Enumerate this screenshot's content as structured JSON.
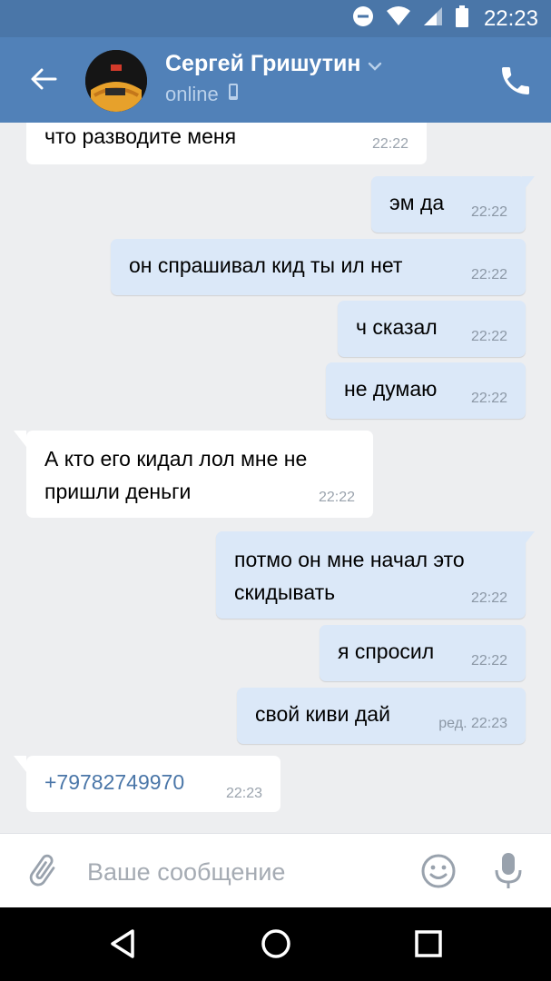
{
  "status_bar": {
    "time": "22:23",
    "icons": [
      "do-not-disturb-icon",
      "wifi-icon",
      "signal-icon",
      "battery-icon"
    ]
  },
  "header": {
    "contact_name": "Сергей Гришутин",
    "status": "online",
    "icons": [
      "back-arrow-icon",
      "chevron-down-icon",
      "mobile-icon",
      "phone-icon"
    ]
  },
  "messages": [
    {
      "dir": "in",
      "text": "что разводите меня",
      "time": "22:22"
    },
    {
      "dir": "out",
      "text": "эм да",
      "time": "22:22"
    },
    {
      "dir": "out",
      "text": "он спрашивал кид ты ил нет",
      "time": "22:22"
    },
    {
      "dir": "out",
      "text": "ч сказал",
      "time": "22:22"
    },
    {
      "dir": "out",
      "text": "не думаю",
      "time": "22:22"
    },
    {
      "dir": "in",
      "lines": [
        "А кто его кидал лол мне не",
        "пришли деньги"
      ],
      "time": "22:22"
    },
    {
      "dir": "out",
      "lines": [
        "потмо он мне начал это",
        "скидывать"
      ],
      "time": "22:22"
    },
    {
      "dir": "out",
      "text": "я спросил",
      "time": "22:22"
    },
    {
      "dir": "out",
      "text": "свой киви дай",
      "time": "ред. 22:23"
    },
    {
      "dir": "in",
      "text": "+79782749970",
      "time": "22:23"
    }
  ],
  "composer": {
    "placeholder": "Ваше сообщение",
    "icons": [
      "paperclip-icon",
      "emoji-icon",
      "microphone-icon"
    ]
  },
  "nav_bar": {
    "icons": [
      "back-triangle-icon",
      "home-circle-icon",
      "recents-square-icon"
    ]
  },
  "colors": {
    "header": "#5181b8",
    "status_bar": "#4a76a8",
    "chat_background": "#edeef0",
    "outgoing_bubble": "#dbe8f8",
    "incoming_bubble": "#ffffff",
    "link": "#4a76a8"
  }
}
